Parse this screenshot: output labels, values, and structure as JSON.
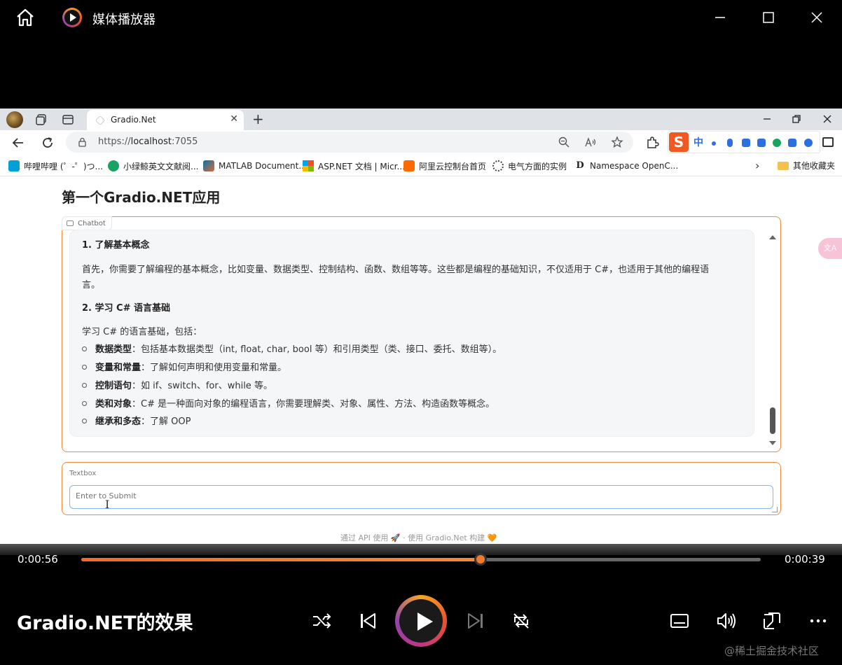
{
  "player": {
    "title": "媒体播放器",
    "now_playing": "Gradio.NET的效果",
    "elapsed": "0:00:56",
    "remaining": "0:00:39",
    "progress_fraction": 0.588,
    "accent_color": "#f07a30"
  },
  "browser": {
    "tab_title": "Gradio.Net",
    "url_scheme": "https://",
    "url_host": "localhost",
    "url_port": ":7055",
    "bookmarks": [
      {
        "label": "哔哩哔哩 (゜-゜)つ...",
        "icon": "bilibili-icon",
        "color": "#00a1d6"
      },
      {
        "label": "小绿鲸英文文献阅...",
        "icon": "whale-icon",
        "color": "#1aa260"
      },
      {
        "label": "MATLAB Document...",
        "icon": "matlab-icon",
        "color": "#e16737"
      },
      {
        "label": "ASP.NET 文档 | Micr...",
        "icon": "microsoft-icon",
        "color": "#f25022"
      },
      {
        "label": "阿里云控制台首页",
        "icon": "aliyun-icon",
        "color": "#ff6a00"
      },
      {
        "label": "电气方面的实例",
        "icon": "gear-icon",
        "color": "#444444"
      },
      {
        "label": "Namespace OpenC...",
        "icon": "d-icon",
        "color": "#222222"
      }
    ],
    "other_bookmarks": "其他收藏夹",
    "ime_label": "中"
  },
  "page": {
    "title": "第一个Gradio.NET应用",
    "chatbot_label": "Chatbot",
    "message": {
      "h1": "1. 了解基本概念",
      "p1a": "首先，你需要了解编程的基本概念，比如变量、数据类型、控制结构、函数、数组等等。这些都是编程的基础知识，不仅适用于 C#，也适用于其他的编程语",
      "p1b": "言。",
      "h2": "2. 学习 C# 语言基础",
      "p2": "学习 C# 的语言基础，包括：",
      "items": [
        {
          "term": "数据类型",
          "desc": "：包括基本数据类型（int, float, char, bool 等）和引用类型（类、接口、委托、数组等）。"
        },
        {
          "term": "变量和常量",
          "desc": "：了解如何声明和使用变量和常量。"
        },
        {
          "term": "控制语句",
          "desc": "：如 if、switch、for、while 等。"
        },
        {
          "term": "类和对象",
          "desc": "：C# 是一种面向对象的编程语言，你需要理解类、对象、属性、方法、构造函数等概念。"
        },
        {
          "term": "继承和多态",
          "desc": "：了解 OOP"
        }
      ]
    },
    "textbox_label": "Textbox",
    "textbox_placeholder": "Enter to Submit",
    "textbox_value": "",
    "footer": "通过 API 使用 🚀 · 使用 Gradio.Net 构建 🧡"
  },
  "watermark": "@稀土掘金技术社区"
}
